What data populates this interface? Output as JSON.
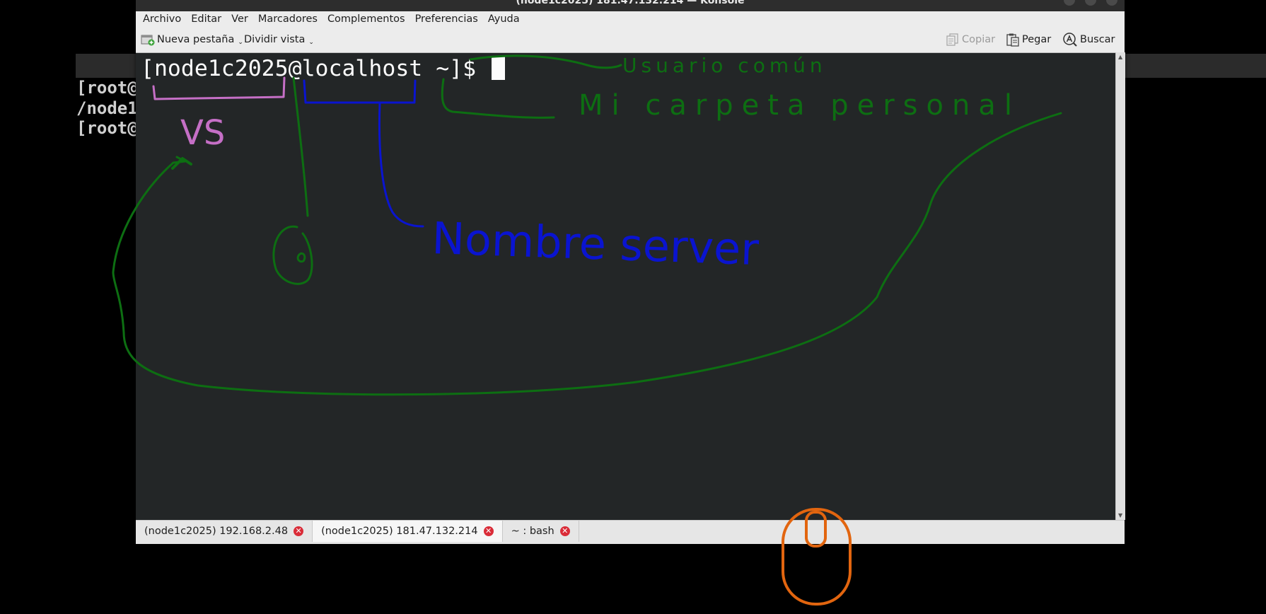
{
  "background_console": {
    "lines": [
      "[root@",
      "/node1",
      "[root@"
    ]
  },
  "window": {
    "title": "(node1c2025) 181.47.132.214 — Konsole"
  },
  "menubar": {
    "items": [
      "Archivo",
      "Editar",
      "Ver",
      "Marcadores",
      "Complementos",
      "Preferencias",
      "Ayuda"
    ]
  },
  "toolbar": {
    "new_tab": "Nueva pestaña",
    "split_view": "Dividir vista",
    "copy": "Copiar",
    "paste": "Pegar",
    "search": "Buscar",
    "copy_enabled": false
  },
  "terminal": {
    "prompt": "[node1c2025@localhost ~]$ "
  },
  "tabs": [
    {
      "label": "(node1c2025) 192.168.2.48",
      "active": false
    },
    {
      "label": "(node1c2025) 181.47.132.214",
      "active": true
    },
    {
      "label": "~ : bash",
      "active": false
    }
  ],
  "annotations": {
    "user_label": "VS",
    "server_label": "Nombre server",
    "common_user_label": "Usuario común",
    "personal_folder_label": "Mi carpeta personal",
    "colors": {
      "pink": "#c56fc6",
      "green": "#0d6e12",
      "blue": "#0a14d0",
      "orange": "#e2650f"
    }
  }
}
